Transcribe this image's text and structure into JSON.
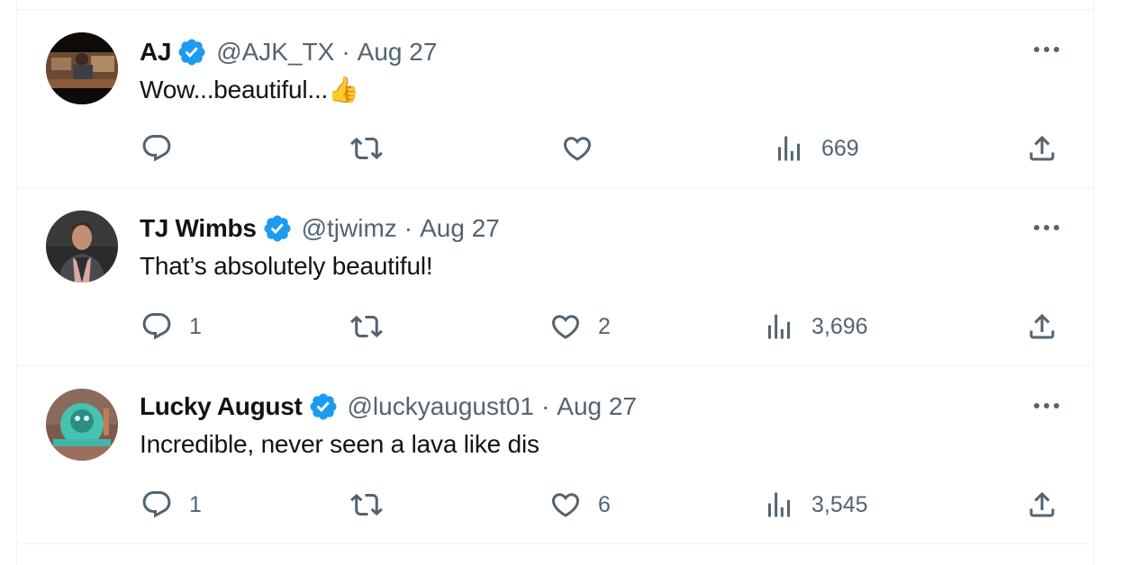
{
  "colors": {
    "text_primary": "#0f1419",
    "text_secondary": "#536471",
    "verified_blue": "#1d9bf0",
    "divider": "#eff3f4"
  },
  "tweets": [
    {
      "display_name": "AJ",
      "handle": "@AJK_TX",
      "separator": "·",
      "date": "Aug 27",
      "text": "Wow...beautiful...👍",
      "replies": "",
      "retweets": "",
      "likes": "",
      "views": "669",
      "verified": true
    },
    {
      "display_name": "TJ Wimbs",
      "handle": "@tjwimz",
      "separator": "·",
      "date": "Aug 27",
      "text": "That’s absolutely beautiful!",
      "replies": "1",
      "retweets": "",
      "likes": "2",
      "views": "3,696",
      "verified": true
    },
    {
      "display_name": "Lucky August",
      "handle": "@luckyaugust01",
      "separator": "·",
      "date": "Aug 27",
      "text": "Incredible, never seen a lava like dis",
      "replies": "1",
      "retweets": "",
      "likes": "6",
      "views": "3,545",
      "verified": true
    }
  ],
  "icons": [
    "verified-badge-icon",
    "more-icon",
    "reply-icon",
    "retweet-icon",
    "like-icon",
    "views-icon",
    "share-icon"
  ]
}
